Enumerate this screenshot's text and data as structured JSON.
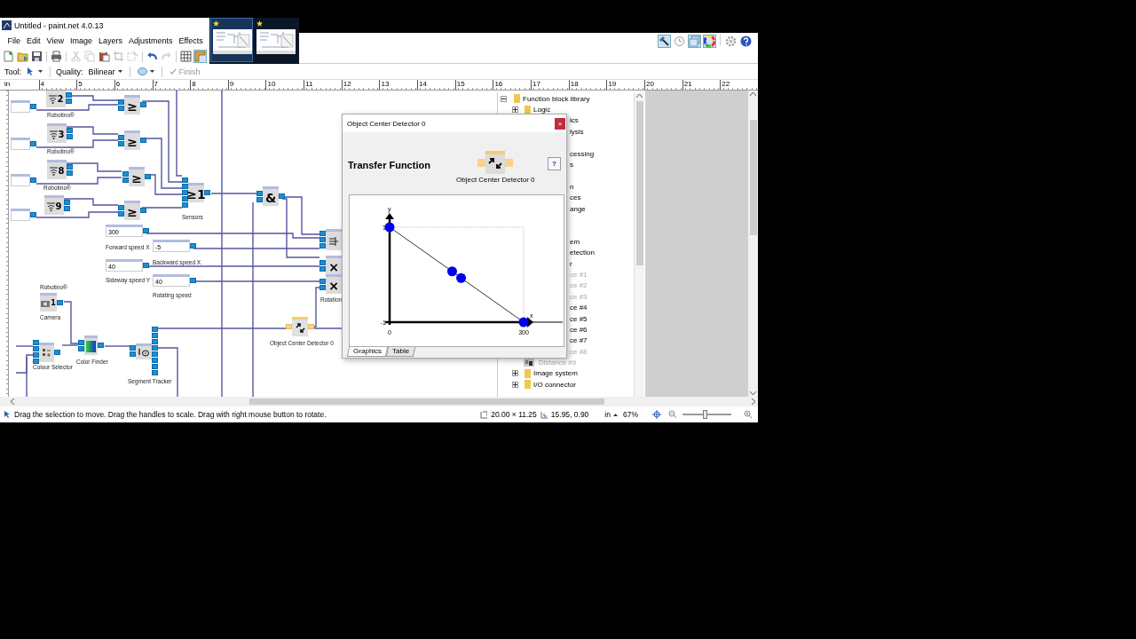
{
  "window": {
    "title": "Untitled - paint.net 4.0.13"
  },
  "image_tabs": [
    {
      "selected": true
    },
    {
      "selected": false
    }
  ],
  "menu": [
    "File",
    "Edit",
    "View",
    "Image",
    "Layers",
    "Adjustments",
    "Effects"
  ],
  "toolbar": [
    {
      "kind": "new",
      "disabled": false,
      "selected": false
    },
    {
      "kind": "open",
      "disabled": false,
      "selected": false
    },
    {
      "kind": "save",
      "disabled": false,
      "selected": false
    },
    {
      "kind": "print",
      "disabled": false,
      "selected": false
    },
    {
      "kind": "cut",
      "disabled": true,
      "selected": false
    },
    {
      "kind": "copy",
      "disabled": true,
      "selected": false
    },
    {
      "kind": "paste",
      "disabled": false,
      "selected": false
    },
    {
      "kind": "crop",
      "disabled": true,
      "selected": false
    },
    {
      "kind": "deselect",
      "disabled": true,
      "selected": false
    },
    {
      "kind": "undo",
      "disabled": false,
      "selected": false
    },
    {
      "kind": "redo",
      "disabled": true,
      "selected": false
    },
    {
      "kind": "grid",
      "disabled": false,
      "selected": false
    },
    {
      "kind": "rulers",
      "disabled": false,
      "selected": true
    }
  ],
  "panel_toggles": [
    {
      "kind": "tools",
      "selected": true
    },
    {
      "kind": "history",
      "selected": false
    },
    {
      "kind": "layers",
      "selected": true
    },
    {
      "kind": "colors",
      "selected": true
    },
    {
      "kind": "settings",
      "selected": false
    },
    {
      "kind": "help",
      "selected": false
    }
  ],
  "tool_options": {
    "tool_label": "Tool:",
    "quality_label": "Quality:",
    "quality": "Bilinear",
    "finish": "Finish",
    "finish_disabled": true
  },
  "ruler": {
    "unit": "in",
    "ticks": [
      "4",
      "5",
      "6",
      "7",
      "8",
      "9",
      "10",
      "11",
      "12",
      "13",
      "14",
      "15",
      "16",
      "17",
      "18",
      "19",
      "20",
      "21",
      "22"
    ]
  },
  "diagram": {
    "blocks": [
      {
        "kind": "constant"
      },
      {
        "kind": "sensor",
        "digit": "2"
      },
      {
        "kind": "compare",
        "symbol": "≥"
      },
      {
        "kind": "constant"
      },
      {
        "kind": "sensor",
        "digit": "3"
      },
      {
        "kind": "compare",
        "symbol": "≥"
      },
      {
        "kind": "constant"
      },
      {
        "kind": "sensor",
        "digit": "8"
      },
      {
        "kind": "compare",
        "symbol": "≥"
      },
      {
        "kind": "constant"
      },
      {
        "kind": "sensor",
        "digit": "9"
      },
      {
        "kind": "compare",
        "symbol": "≥"
      },
      {
        "kind": "or",
        "symbol": "≥1"
      },
      {
        "kind": "and",
        "symbol": "&"
      },
      {
        "kind": "value",
        "value": "300"
      },
      {
        "kind": "value",
        "value": "-5"
      },
      {
        "kind": "value",
        "value": "40"
      },
      {
        "kind": "value",
        "value": "40"
      },
      {
        "kind": "mux"
      },
      {
        "kind": "multiply",
        "symbol": "×"
      },
      {
        "kind": "multiply",
        "symbol": "×"
      },
      {
        "kind": "camera",
        "digit": "1"
      },
      {
        "kind": "colour_selector"
      },
      {
        "kind": "color_finder"
      },
      {
        "kind": "tracker"
      },
      {
        "kind": "detector"
      }
    ],
    "labels": [
      "Robotino®",
      "Robotino®",
      "Robotino®",
      "Sensors",
      "Forward speed X",
      "Backward speed X",
      "Sideway speed Y",
      "Rotating speed",
      "Rotation",
      "Robotino®",
      "Camera",
      "Colour Selector",
      "Color Finder",
      "Segment Tracker",
      "Object Center Detector 0"
    ]
  },
  "library_tree": {
    "items": [
      {
        "label": "Function block library",
        "kind": "folder",
        "expanded": true,
        "children": [
          {
            "label": "Logic",
            "kind": "folder",
            "expanded": false
          },
          {
            "label": "ics",
            "kind": "partial"
          },
          {
            "label": "lysis",
            "kind": "partial"
          },
          {
            "label": "cessing",
            "kind": "partial"
          },
          {
            "label": "s",
            "kind": "partial"
          },
          {
            "label": "n",
            "kind": "partial"
          },
          {
            "label": "ces",
            "kind": "partial"
          },
          {
            "label": "ange",
            "kind": "partial"
          },
          {
            "label": "em",
            "kind": "partial"
          },
          {
            "label": "etection",
            "kind": "partial"
          },
          {
            "label": "r",
            "kind": "partial",
            "children": [
              {
                "label": "ce #1",
                "kind": "partial",
                "disabled": true
              },
              {
                "label": "ce #2",
                "kind": "partial",
                "disabled": true
              },
              {
                "label": "ce #3",
                "kind": "partial",
                "disabled": true
              },
              {
                "label": "ce #4",
                "kind": "partial",
                "disabled": false
              },
              {
                "label": "ce #5",
                "kind": "partial",
                "disabled": false
              },
              {
                "label": "ce #6",
                "kind": "partial",
                "disabled": false
              },
              {
                "label": "ce #7",
                "kind": "partial",
                "disabled": false
              },
              {
                "label": "ce #8",
                "kind": "partial",
                "disabled": true
              },
              {
                "label": "Distance #9",
                "kind": "sensor",
                "disabled": true
              }
            ]
          },
          {
            "label": "Image system",
            "kind": "folder",
            "expanded": false
          },
          {
            "label": "I/O connector",
            "kind": "folder",
            "expanded": false
          }
        ]
      }
    ]
  },
  "dialog": {
    "title": "Object Center Detector 0",
    "close": "×",
    "heading": "Transfer Function",
    "block_caption": "Object Center Detector 0",
    "help": "?",
    "chart_data": {
      "type": "line",
      "xlabel": "x",
      "ylabel": "y",
      "x": [
        0,
        140,
        160,
        300
      ],
      "values": [
        1,
        0.07,
        -0.07,
        -1
      ],
      "xlim": [
        0,
        300
      ],
      "ylim": [
        -1,
        1
      ],
      "xticks": [
        0,
        300
      ],
      "yticks": [
        -1,
        1
      ],
      "marker": "circle"
    },
    "tabs": [
      {
        "label": "Graphics",
        "selected": true
      },
      {
        "label": "Table",
        "selected": false
      }
    ]
  },
  "status_bar": {
    "hint": "Drag the selection to move. Drag the handles to scale. Drag with right mouse button to rotate.",
    "image_size": "20.00 × 11.25",
    "cursor": "15.95, 0.90",
    "units": "in",
    "zoom": "67%",
    "zoom_slider": {
      "level": 0.47
    }
  }
}
